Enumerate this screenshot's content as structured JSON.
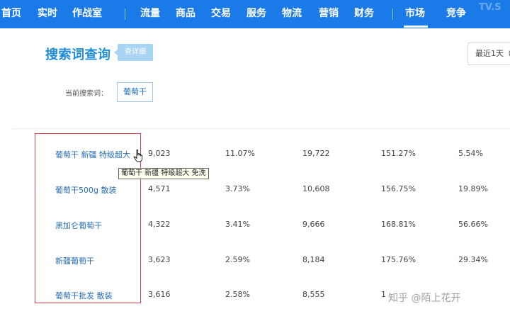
{
  "nav": {
    "items": [
      "首页",
      "实时",
      "作战室",
      "流量",
      "商品",
      "交易",
      "服务",
      "物流",
      "营销",
      "财务",
      "市场",
      "竞争"
    ],
    "active": "市场",
    "watermark": "TV.S"
  },
  "header": {
    "title": "搜索词查询",
    "badge": "查详细",
    "date_range": "最近1天（",
    "current_keyword_label": "当前搜索词：",
    "current_keyword": "葡萄干"
  },
  "table": {
    "rows": [
      {
        "keyword": "葡萄干 新疆 特级超大 ...",
        "c1": "9,023",
        "c2": "11.07%",
        "c3": "19,722",
        "c4": "151.27%",
        "c5": "5.54%"
      },
      {
        "keyword": "葡萄干500g 散装",
        "c1": "4,571",
        "c2": "3.73%",
        "c3": "10,608",
        "c4": "156.75%",
        "c5": "19.89%"
      },
      {
        "keyword": "黑加仑葡萄干",
        "c1": "4,322",
        "c2": "3.41%",
        "c3": "9,666",
        "c4": "168.81%",
        "c5": "56.66%"
      },
      {
        "keyword": "新疆葡萄干",
        "c1": "3,623",
        "c2": "2.59%",
        "c3": "8,184",
        "c4": "175.76%",
        "c5": "29.34%"
      },
      {
        "keyword": "葡萄干批发 散装",
        "c1": "3,616",
        "c2": "2.58%",
        "c3": "8,555",
        "c4": "1",
        "c5": ""
      }
    ]
  },
  "tooltip": "葡萄干 新疆 特级超大 免洗",
  "watermark": "知乎 @陌上花开",
  "colors": {
    "nav_bg": "#1a7be8",
    "title": "#1d8dd8",
    "link": "#2a6fb5",
    "highlight": "#d9424a"
  }
}
